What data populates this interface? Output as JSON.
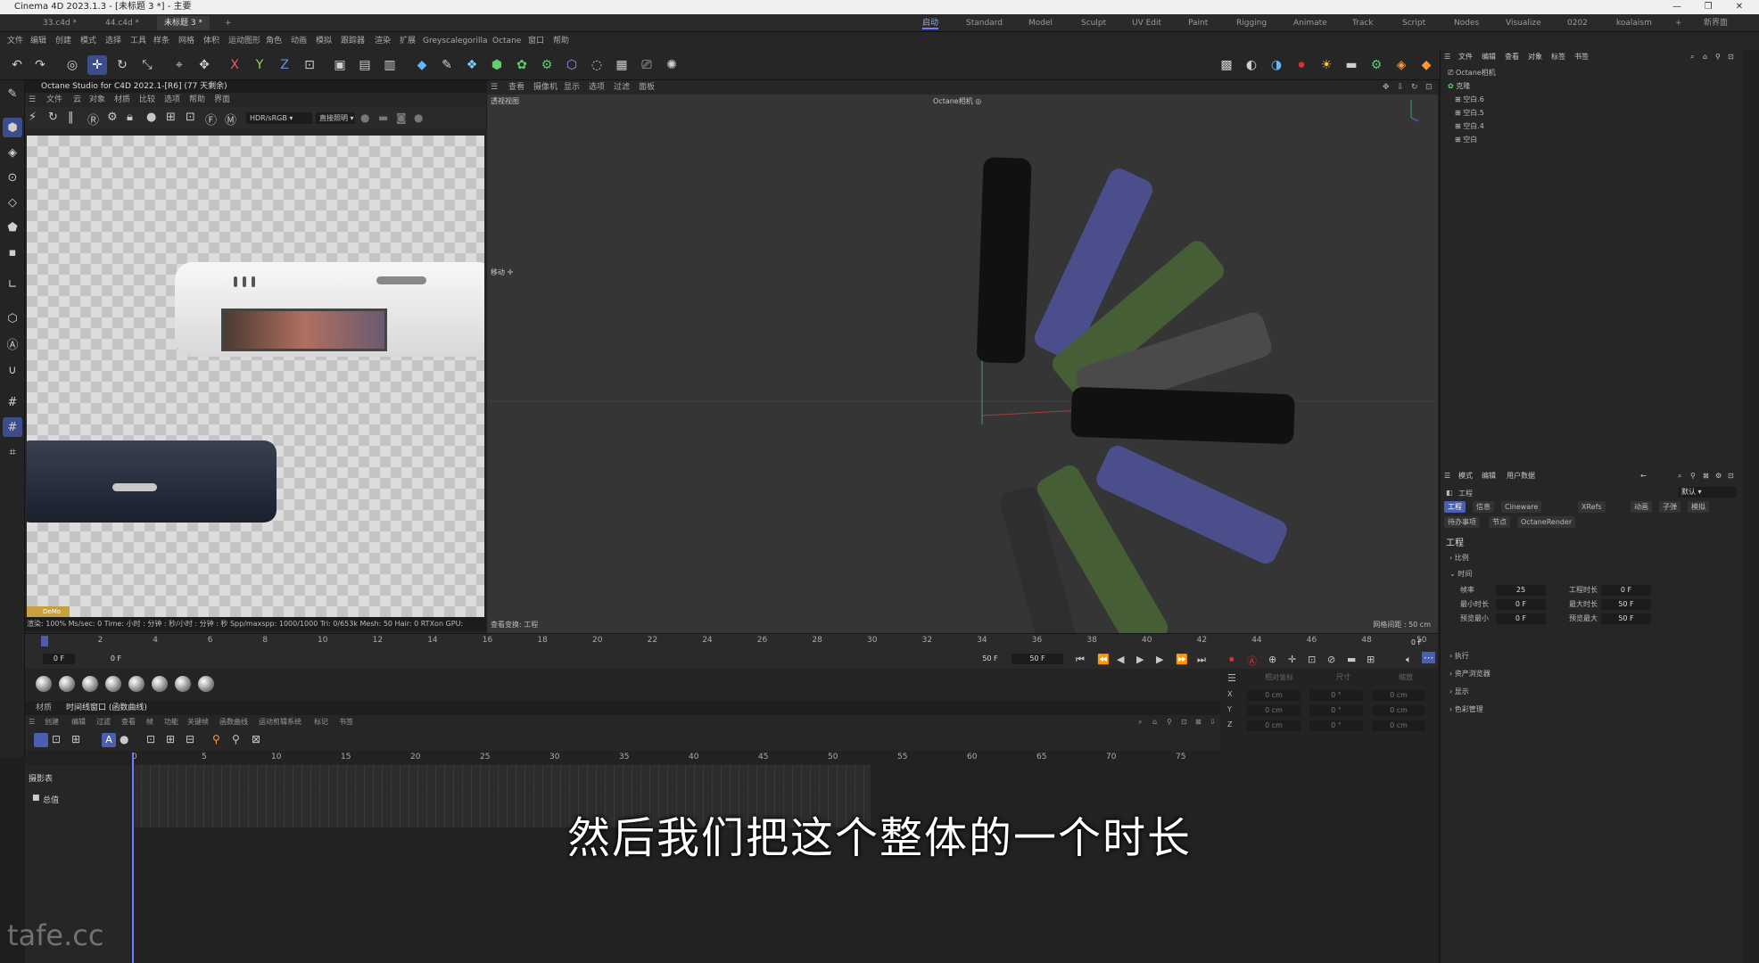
{
  "window": {
    "title": "Cinema 4D 2023.1.3 - [未标题 3 *] - 主要",
    "controls": [
      "—",
      "❐",
      "✕"
    ]
  },
  "file_tabs": [
    "33.c4d *",
    "44.c4d *",
    "未标题 3 *",
    "+"
  ],
  "layouts": [
    "启动",
    "Standard",
    "Model",
    "Sculpt",
    "UV Edit",
    "Paint",
    "Rigging",
    "Animate",
    "Track",
    "Script",
    "Nodes",
    "Visualize",
    "0202",
    "koalaism",
    "+",
    "新界面"
  ],
  "menus": [
    "文件",
    "编辑",
    "创建",
    "模式",
    "选择",
    "工具",
    "样条",
    "网格",
    "体积",
    "运动图形",
    "角色",
    "动画",
    "模拟",
    "跟踪器",
    "渲染",
    "扩展",
    "Greyscalegorilla",
    "Octane",
    "窗口",
    "帮助"
  ],
  "toolbar": {
    "x_axis": "X",
    "y_axis": "Y",
    "z_axis": "Z"
  },
  "octane_panel": {
    "title": "Octane Studio for C4D 2022.1-[R6] (77 天剩余)",
    "menu": [
      "文件",
      "云",
      "对象",
      "材质",
      "比较",
      "选项",
      "帮助",
      "界面"
    ],
    "color_mode": "HDR/sRGB",
    "render_mode": "直接照明",
    "status": "渲染: 100%   Ms/sec: 0   Time: 小时 : 分钟 : 秒/小时 : 分钟 : 秒   Spp/maxspp: 1000/1000   Tri: 0/653k   Mesh: 50   Hair: 0   RTXon   GPU:",
    "badge": "DeMo"
  },
  "viewport": {
    "menu": [
      "查看",
      "摄像机",
      "显示",
      "选项",
      "过滤",
      "面板"
    ],
    "label": "透视视图",
    "camera": "Octane相机 ◎",
    "move_label": "移动 ✛",
    "footer_left": "查看变换: 工程",
    "footer_right": "网格间距 : 50 cm"
  },
  "ruler": {
    "ticks": [
      "0",
      "2",
      "4",
      "6",
      "8",
      "10",
      "12",
      "14",
      "16",
      "18",
      "20",
      "22",
      "24",
      "26",
      "28",
      "30",
      "32",
      "34",
      "36",
      "38",
      "40",
      "42",
      "44",
      "46",
      "48",
      "50"
    ],
    "current_frame": "0 F",
    "start": "0 F",
    "start2": "0 F",
    "end": "50 F",
    "end2": "50 F",
    "right_frame": "0 F"
  },
  "timeline": {
    "tabs": [
      "材质",
      "时间线窗口 (函数曲线)"
    ],
    "menu": [
      "创建",
      "编辑",
      "过滤",
      "查看",
      "帧",
      "功能",
      "关键帧",
      "函数曲线",
      "运动剪辑系统",
      "标记",
      "书签"
    ],
    "ruler": [
      "0",
      "5",
      "10",
      "15",
      "20",
      "25",
      "30",
      "35",
      "40",
      "45",
      "50",
      "55",
      "60",
      "65",
      "70",
      "75"
    ],
    "left_items": [
      "摄影表",
      "总值"
    ]
  },
  "coords": {
    "headers": [
      "相对坐标",
      "尺寸",
      "缩放"
    ],
    "rows": [
      {
        "axis": "X",
        "pos": "0 cm",
        "rot": "0 °",
        "size": "0 cm"
      },
      {
        "axis": "Y",
        "pos": "0 cm",
        "rot": "0 °",
        "size": "0 cm"
      },
      {
        "axis": "Z",
        "pos": "0 cm",
        "rot": "0 °",
        "size": "0 cm"
      }
    ]
  },
  "object_manager": {
    "menu": [
      "文件",
      "编辑",
      "查看",
      "对象",
      "标签",
      "书签"
    ],
    "objects": [
      "Octane相机",
      "克隆",
      "空白.6",
      "空白.5",
      "空白.4",
      "空白"
    ]
  },
  "attributes": {
    "menu": [
      "模式",
      "编辑",
      "用户数据"
    ],
    "title": "工程",
    "preset": "默认",
    "tabs_row1": [
      "工程",
      "信息",
      "Cineware",
      "XRefs",
      "动画",
      "子弹",
      "模拟"
    ],
    "tabs_row2": [
      "待办事项",
      "节点",
      "OctaneRender"
    ],
    "section": "工程",
    "groups": [
      "比例",
      "时间",
      "执行",
      "资产浏览器",
      "显示",
      "色彩管理"
    ],
    "time_fields": [
      {
        "label": "帧率",
        "value": "25",
        "label2": "工程时长",
        "value2": "0 F"
      },
      {
        "label": "最小时长",
        "value": "0 F",
        "label2": "最大时长",
        "value2": "50 F"
      },
      {
        "label": "预览最小",
        "value": "0 F",
        "label2": "预览最大",
        "value2": "50 F"
      }
    ]
  },
  "subtitle": "然后我们把这个整体的一个时长",
  "watermark": "tafe.cc",
  "colors": {
    "accent": "#4b5fb0",
    "blue_phone": "#4a4f8c",
    "green_phone": "#465e36",
    "grey_phone": "#4a4a4a"
  }
}
